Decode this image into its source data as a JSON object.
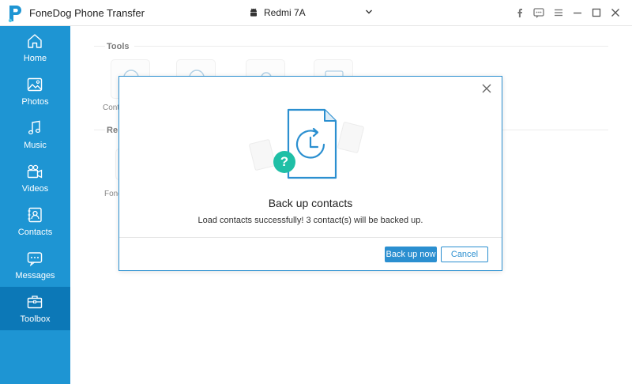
{
  "app": {
    "title": "FoneDog Phone Transfer",
    "brand_color": "#1e95d3",
    "active_color": "#0c78b7"
  },
  "device": {
    "name": "Redmi 7A",
    "icon": "android-icon"
  },
  "window_controls": [
    "facebook-icon",
    "feedback-icon",
    "menu-icon",
    "minimize-icon",
    "maximize-icon",
    "close-icon"
  ],
  "sidebar": {
    "items": [
      {
        "label": "Home",
        "icon": "home-icon",
        "active": false
      },
      {
        "label": "Photos",
        "icon": "photos-icon",
        "active": false
      },
      {
        "label": "Music",
        "icon": "music-icon",
        "active": false
      },
      {
        "label": "Videos",
        "icon": "videos-icon",
        "active": false
      },
      {
        "label": "Contacts",
        "icon": "contacts-icon",
        "active": false
      },
      {
        "label": "Messages",
        "icon": "messages-icon",
        "active": false
      },
      {
        "label": "Toolbox",
        "icon": "toolbox-icon",
        "active": true
      }
    ]
  },
  "main": {
    "tools_heading": "Tools",
    "recommended_heading": "Re",
    "tool_label_partial": "Conta",
    "recommended_label_partial": "Fone"
  },
  "dialog": {
    "title": "Back up contacts",
    "message": "Load contacts successfully! 3 contact(s) will be backed up.",
    "primary_button": "Back up now",
    "secondary_button": "Cancel",
    "badge_symbol": "?",
    "accent_color": "#2b8fd0",
    "badge_color": "#1fbfa6"
  }
}
